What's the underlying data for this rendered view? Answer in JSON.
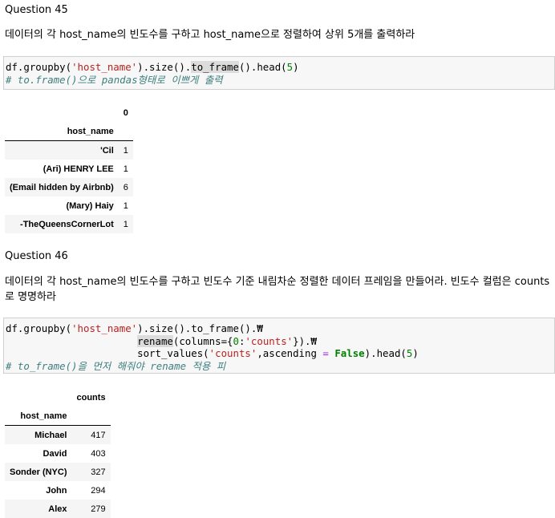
{
  "q45": {
    "title": "Question 45",
    "text": "데이터의 각 host_name의 빈도수를 구하고 host_name으로 정렬하여 상위 5개를 출력하라",
    "code": {
      "p1": "df.groupby(",
      "s1": "'host_name'",
      "p2": ").size().",
      "hl": "to_frame",
      "p3": "().head(",
      "n1": "5",
      "p4": ")",
      "comment": "# to.frame()으로 pandas형태로 이쁘게 출력"
    },
    "table": {
      "col_header": "0",
      "index_name": "host_name",
      "rows": [
        {
          "idx": "'Cil",
          "val": "1"
        },
        {
          "idx": "(Ari) HENRY LEE",
          "val": "1"
        },
        {
          "idx": "(Email hidden by Airbnb)",
          "val": "6"
        },
        {
          "idx": "(Mary) Haiy",
          "val": "1"
        },
        {
          "idx": "-TheQueensCornerLot",
          "val": "1"
        }
      ]
    }
  },
  "q46": {
    "title": "Question 46",
    "text": "데이터의 각 host_name의 빈도수를 구하고 빈도수 기준 내림차순 정렬한 데이터 프레임을 만들어라. 빈도수 컬럼은 counts로 명명하라",
    "code": {
      "l1a": "df.groupby(",
      "l1s": "'host_name'",
      "l1b": ").size().to_frame().₩",
      "l2hl": "rename",
      "l2a": "(columns={",
      "l2n": "0",
      "l2b": ":",
      "l2s": "'counts'",
      "l2c": "}).₩",
      "l3a": "sort_values(",
      "l3s": "'counts'",
      "l3b": ",ascending ",
      "l3op": "=",
      "l3kw": "False",
      "l3c": ").head(",
      "l3n": "5",
      "l3d": ")",
      "comment": "# to_frame()을 먼저 해줘야 rename 적용 피"
    },
    "table": {
      "col_header": "counts",
      "index_name": "host_name",
      "rows": [
        {
          "idx": "Michael",
          "val": "417"
        },
        {
          "idx": "David",
          "val": "403"
        },
        {
          "idx": "Sonder (NYC)",
          "val": "327"
        },
        {
          "idx": "John",
          "val": "294"
        },
        {
          "idx": "Alex",
          "val": "279"
        }
      ]
    }
  },
  "colors": {
    "string": "#ba2121",
    "number": "#008000",
    "comment": "#408080",
    "keyword": "#008000"
  }
}
